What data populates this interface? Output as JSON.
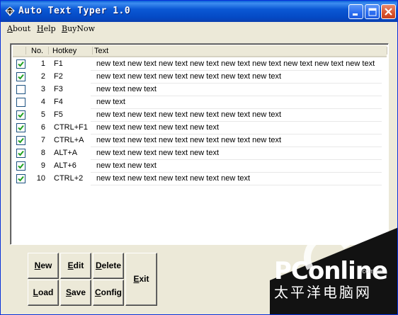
{
  "window": {
    "title": "Auto Text Typer 1.0"
  },
  "menu": [
    {
      "label": "About"
    },
    {
      "label": "Help"
    },
    {
      "label": "BuyNow"
    }
  ],
  "list": {
    "columns": [
      "No.",
      "Hotkey",
      "Text"
    ],
    "rows": [
      {
        "checked": true,
        "no": "1",
        "hotkey": "F1",
        "text": "new text new text new text new text new text new text new text new text new text"
      },
      {
        "checked": true,
        "no": "2",
        "hotkey": "F2",
        "text": "new text new text new text new text new text new text"
      },
      {
        "checked": false,
        "no": "3",
        "hotkey": "F3",
        "text": "new text new text"
      },
      {
        "checked": false,
        "no": "4",
        "hotkey": "F4",
        "text": "new text"
      },
      {
        "checked": true,
        "no": "5",
        "hotkey": "F5",
        "text": "new text new text new text new text new text new text"
      },
      {
        "checked": true,
        "no": "6",
        "hotkey": "CTRL+F1",
        "text": "new text new text new text new text"
      },
      {
        "checked": true,
        "no": "7",
        "hotkey": "CTRL+A",
        "text": "new text new text new text new text new text new text"
      },
      {
        "checked": true,
        "no": "8",
        "hotkey": "ALT+A",
        "text": "new text new text new text new text"
      },
      {
        "checked": true,
        "no": "9",
        "hotkey": "ALT+6",
        "text": "new text new text"
      },
      {
        "checked": true,
        "no": "10",
        "hotkey": "CTRL+2",
        "text": "new text new text new text new text new text"
      }
    ]
  },
  "buttons": {
    "new": "New",
    "edit": "Edit",
    "delete": "Delete",
    "load": "Load",
    "save": "Save",
    "config": "Config",
    "exit": "Exit"
  },
  "watermark": {
    "brand": "PConline",
    "domain": ".com.cn",
    "cn": "太平洋电脑网"
  },
  "colors": {
    "titlebar": "#0b58d5",
    "check": "#21a121",
    "close": "#d9542e"
  },
  "icons": {
    "app": "diamond-icon",
    "minimize": "minimize-icon",
    "maximize": "maximize-icon",
    "close": "close-icon",
    "check": "checkmark-icon"
  }
}
